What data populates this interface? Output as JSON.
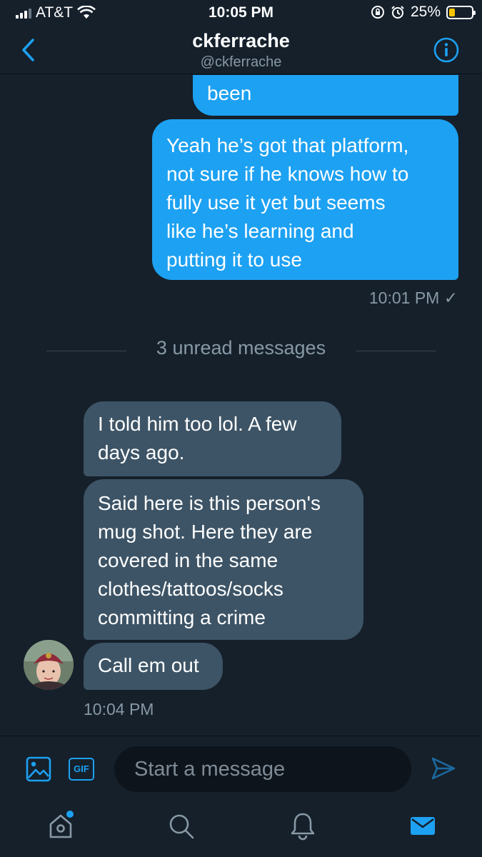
{
  "status_bar": {
    "carrier": "AT&T",
    "time": "10:05 PM",
    "battery_percent": "25%",
    "battery_level": 0.25,
    "icons": [
      "signal-icon",
      "wifi-icon",
      "orientation-lock-icon",
      "alarm-icon",
      "battery-icon"
    ]
  },
  "header": {
    "title": "ckferrache",
    "handle": "@ckferrache",
    "back_icon": "chevron-left-icon",
    "info_icon": "info-icon",
    "accent_color": "#1da1f2"
  },
  "conversation": {
    "sent_messages": [
      {
        "text": "been"
      },
      {
        "lines": [
          "Yeah he’s got that platform,",
          "not sure if he knows how to",
          "fully use it yet but seems",
          "like he’s learning and",
          "putting it to use"
        ]
      }
    ],
    "sent_timestamp": "10:01 PM",
    "read_check": "✓",
    "unread_divider": "3 unread messages",
    "received_messages": [
      {
        "lines": [
          "I told him too lol. A few",
          "days ago."
        ]
      },
      {
        "lines": [
          "Said here is this person's",
          "mug shot. Here they are",
          "covered in the same",
          "clothes/tattoos/socks",
          "committing a crime"
        ]
      },
      {
        "lines": [
          "Call em out"
        ]
      }
    ],
    "received_timestamp": "10:04 PM",
    "avatar_icon": "avatar"
  },
  "composer": {
    "placeholder": "Start a message",
    "image_icon": "image-icon",
    "gif_label": "GIF",
    "send_icon": "send-icon"
  },
  "tabbar": {
    "items": [
      "home-icon",
      "search-icon",
      "notifications-icon",
      "messages-icon"
    ]
  },
  "colors": {
    "background": "#15202b",
    "sent_bubble": "#1da1f2",
    "received_bubble": "#3d5466",
    "muted_text": "#8899a6"
  }
}
